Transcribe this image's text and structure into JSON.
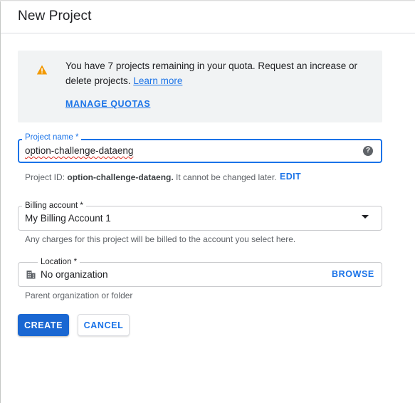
{
  "dialog": {
    "title": "New Project"
  },
  "quota": {
    "message": "You have 7 projects remaining in your quota. Request an increase or delete projects.",
    "learn_more": "Learn more",
    "manage_quotas": "MANAGE QUOTAS",
    "icon": "warning-icon",
    "icon_color": "#f29900"
  },
  "project_name": {
    "label": "Project name *",
    "value": "option-challenge-dataeng",
    "help_icon": "help-icon",
    "id_prefix": "Project ID:",
    "id_value": "option-challenge-dataeng.",
    "id_suffix": "It cannot be changed later.",
    "edit": "EDIT"
  },
  "billing": {
    "label": "Billing account *",
    "value": "My Billing Account 1",
    "helper": "Any charges for this project will be billed to the account you select here."
  },
  "location": {
    "label": "Location *",
    "value": "No organization",
    "icon": "building-icon",
    "browse": "BROWSE",
    "helper": "Parent organization or folder"
  },
  "actions": {
    "create": "CREATE",
    "cancel": "CANCEL"
  },
  "colors": {
    "accent": "#1a73e8",
    "primary_button": "#1a67d2",
    "quota_bg": "#f1f3f4"
  }
}
